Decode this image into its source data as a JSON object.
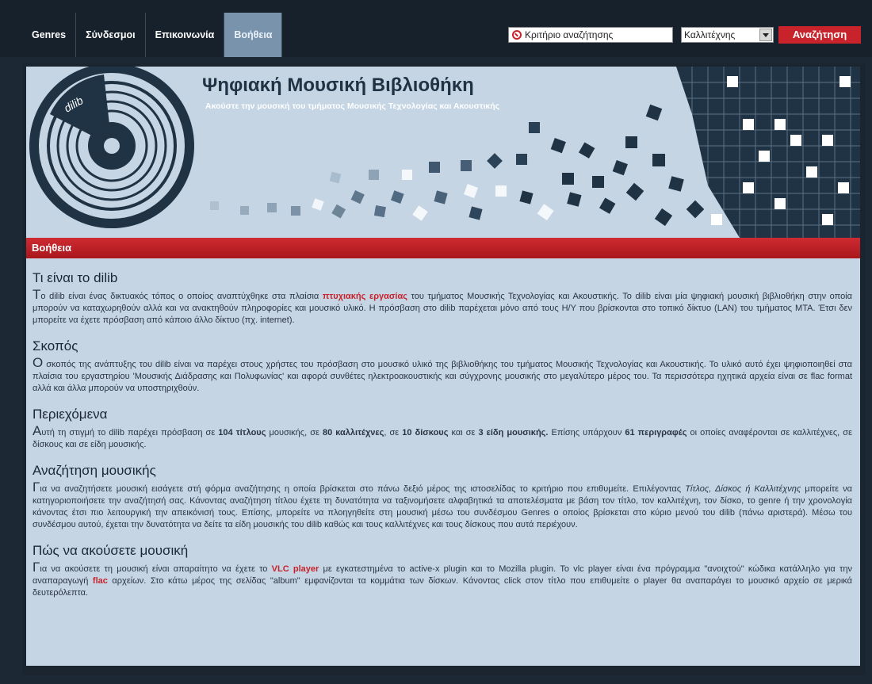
{
  "nav": {
    "items": [
      {
        "label": "Genres",
        "active": false
      },
      {
        "label": "Σύνδεσμοι",
        "active": false
      },
      {
        "label": "Επικοινωνία",
        "active": false
      },
      {
        "label": "Βοήθεια",
        "active": true
      }
    ]
  },
  "search": {
    "value": "Κριτήριο αναζήτησης",
    "type_selected": "Καλλιτέχνης",
    "button_label": "Αναζήτηση"
  },
  "banner": {
    "logo_text": "dilib",
    "title": "Ψηφιακή Μουσική Βιβλιοθήκη",
    "subtitle": "Ακούστε την μουσική του τμήματος Μουσικής Τεχνολογίας και Ακουστικής"
  },
  "section_title": "Βοήθεια",
  "colors": {
    "accent": "#c8222a",
    "background": "#c5d5e4",
    "dark": "#1c2833"
  },
  "sections": {
    "what": {
      "heading": "Τι είναι το dilib",
      "first_letter": "Τ",
      "p1": "ο dilib είναι ένας δικτυακός τόπος ο οποίος αναπτύχθηκε στα πλαίσια ",
      "link": "πτυχιακής εργασίας",
      "p2": " του τμήματος Μουσικής Τεχνολογίας και Ακουστικής. Το dilib είναι μία ψηφιακή μουσική βιβλιοθήκη στην οποία μπορούν να καταχωρηθούν αλλά και να ανακτηθούν πληροφορίες και μουσικό υλικό. Η πρόσβαση στο dilib παρέχεται μόνο από τους Η/Υ που βρίσκονται στο τοπικό δίκτυο (LAN) του τμήματος ΜΤΑ. Έτσι δεν μπορείτε να έχετε πρόσβαση από κάποιο άλλο δίκτυο (πχ. internet)."
    },
    "goal": {
      "heading": "Σκοπός",
      "first_letter": "Ο",
      "p1": " σκοπός της ανάπτυξης του dilib είναι να παρέχει στους χρήστες του πρόσβαση στο μουσικό υλικό της βιβλιοθήκης του τμήματος Μουσικής Τεχνολογίας και Ακουστικής. Το υλικό αυτό έχει ψηφιοποιηθεί στα πλαίσια του εργαστηρίου 'Μουσικής Διάδρασης και Πολυφωνίας' και αφορά συνθέτες ηλεκτροακουστικής και σύγχρονης μουσικής στο μεγαλύτερο μέρος του. Τα περισσότερα ηχητικά αρχεία είναι σε flac format αλλά και άλλα μπορούν να υποστηριχθούν."
    },
    "contents": {
      "heading": "Περιεχόμενα",
      "first_letter": "Α",
      "p1": "υτή τη στιγμή το dilib παρέχει πρόσβαση σε ",
      "b1": "104 τίτλους",
      "p2": " μουσικής, σε ",
      "b2": "80 καλλιτέχνες",
      "p3": ", σε ",
      "b3": "10 δίσκους",
      "p4": " και σε ",
      "b4": "3 είδη μουσικής.",
      "p5": " Επίσης υπάρχουν ",
      "b5": "61 περιγραφές",
      "p6": " οι οποίες αναφέρονται σε καλλιτέχνες, σε δίσκους και σε είδη μουσικής."
    },
    "search": {
      "heading": "Αναζήτηση μουσικής",
      "first_letter": "Γ",
      "p1": "ια να αναζητήσετε μουσική εισάγετε στή φόρμα αναζήτησης η οποία βρίσκεται στο πάνω δεξιό μέρος της ιστοσελίδας το κριτήριο που επιθυμείτε. Επιλέγοντας ",
      "i1": "Τίτλος, Δίσκος ή Καλλιτέχνης",
      "p2": " μπορείτε να κατηγοριοποιήσετε την αναζήτησή σας. Κάνοντας αναζήτηση τίτλου έχετε τη δυνατότητα να ταξινομήσετε αλφαβητικά τα αποτελέσματα με βάση τον τίτλο, τον καλλιτέχνη, τον δίσκο, το genre ή την χρονολογία κάνοντας έτσι πιο λειτουργική την απεικόνισή τους. Επίσης, μπορείτε να πλοηγηθείτε στη μουσική μέσω του συνδέσμου Genres ο οποίος βρίσκεται στο κύριο μενού του dilib (πάνω αριστερά). Μέσω του συνδέσμου αυτού, έχεται την δυνατότητα να δείτε τα είδη μουσικής του dilib καθώς και τους καλλιτέχνες και τους δίσκους που αυτά περιέχουν."
    },
    "listen": {
      "heading": "Πώς να ακούσετε μουσική",
      "first_letter": "Γ",
      "p1": "ια να ακούσετε τη μουσική είναι απαραίτητο να έχετε το ",
      "link1": "VLC player",
      "p2": " με εγκατεστημένα το active-x plugin και το Mozilla plugin. Το vlc player είναι ένα πρόγραμμα \"ανοιχτού\" κώδικα κατάλληλο για την αναπαραγωγή ",
      "link2": "flac",
      "p3": " αρχείων. Στο κάτω μέρος της σελίδας \"album\" εμφανίζονται τα κομμάτια των δίσκων. Κάνοντας click στον τίτλο που επιθυμείτε ο player θα αναπαράγει το μουσικό αρχείο σε μερικά δευτερόλεπτα."
    }
  }
}
